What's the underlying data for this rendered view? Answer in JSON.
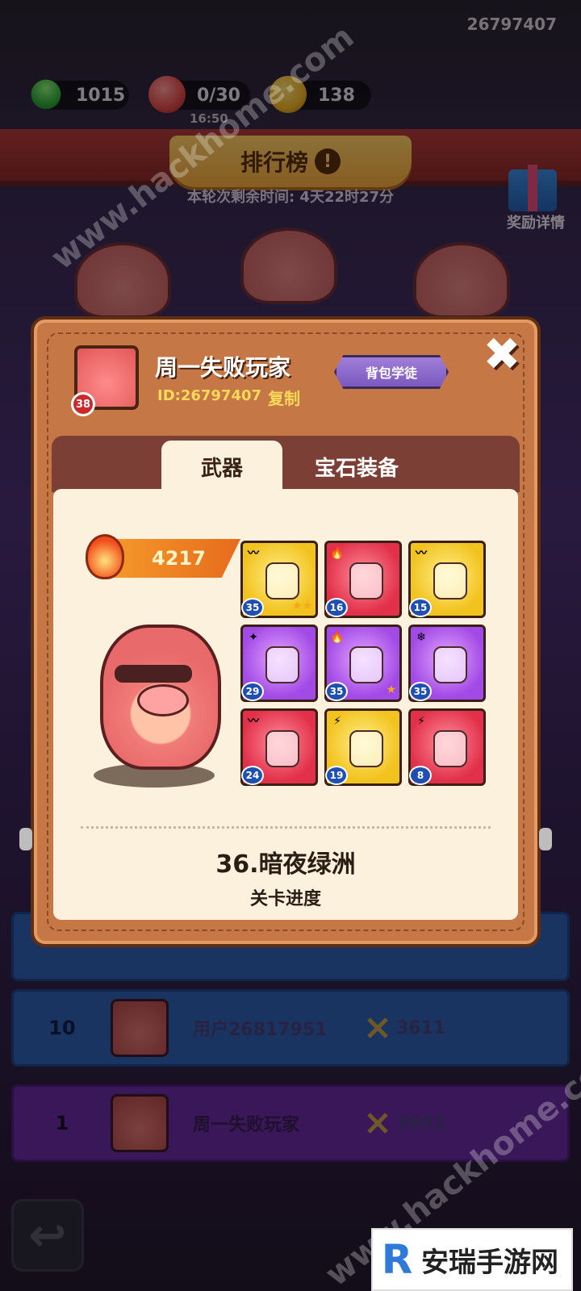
{
  "header": {
    "account_id": "26797407",
    "resources": [
      {
        "icon": "green-gem-icon",
        "value": "1015"
      },
      {
        "icon": "meat-icon",
        "value": "0/30"
      },
      {
        "icon": "coin-icon",
        "value": "138"
      }
    ],
    "timer": "16:50"
  },
  "leaderboard": {
    "title": "排行榜",
    "info_icon": "!",
    "remaining_time": "本轮次剩余时间:  4天22时27分",
    "reward_label": "奖励详情",
    "rows": [
      {
        "rank": "10",
        "name": "用户26817951",
        "score": "3611"
      },
      {
        "rank": "1",
        "name": "周一失败玩家",
        "score": "3692",
        "self": true
      }
    ]
  },
  "profile": {
    "level": "38",
    "name": "周一失败玩家",
    "id_text": "ID:26797407",
    "copy_label": "复制",
    "badge_label": "背包学徒",
    "close_icon": "✖",
    "tabs": [
      {
        "label": "武器",
        "active": true
      },
      {
        "label": "宝石装备",
        "active": false
      }
    ],
    "power": "4217",
    "weapons": [
      {
        "bg": "yellow",
        "element": "wind",
        "level": "35",
        "stars": "★★"
      },
      {
        "bg": "red",
        "element": "fire",
        "level": "16",
        "stars": ""
      },
      {
        "bg": "yellow",
        "element": "wind",
        "level": "15",
        "stars": ""
      },
      {
        "bg": "purple",
        "element": "light",
        "level": "29",
        "stars": ""
      },
      {
        "bg": "purple",
        "element": "fire",
        "level": "35",
        "stars": "★"
      },
      {
        "bg": "purple",
        "element": "ice",
        "level": "35",
        "stars": ""
      },
      {
        "bg": "red",
        "element": "wind",
        "level": "24",
        "stars": ""
      },
      {
        "bg": "yellow",
        "element": "thunder",
        "level": "19",
        "stars": ""
      },
      {
        "bg": "red",
        "element": "thunder",
        "level": "8",
        "stars": ""
      }
    ],
    "stage": "36.暗夜绿洲",
    "stage_label": "关卡进度"
  },
  "watermarks": [
    "www.hackhome.com",
    "www.hackhome.com"
  ],
  "logo": {
    "letter": "R",
    "text": "安瑞手游网",
    "url": "www.szerg.com"
  },
  "colors": {
    "modal": "#c57745",
    "content": "#fbf1dc",
    "accent": "#f8d95a"
  }
}
